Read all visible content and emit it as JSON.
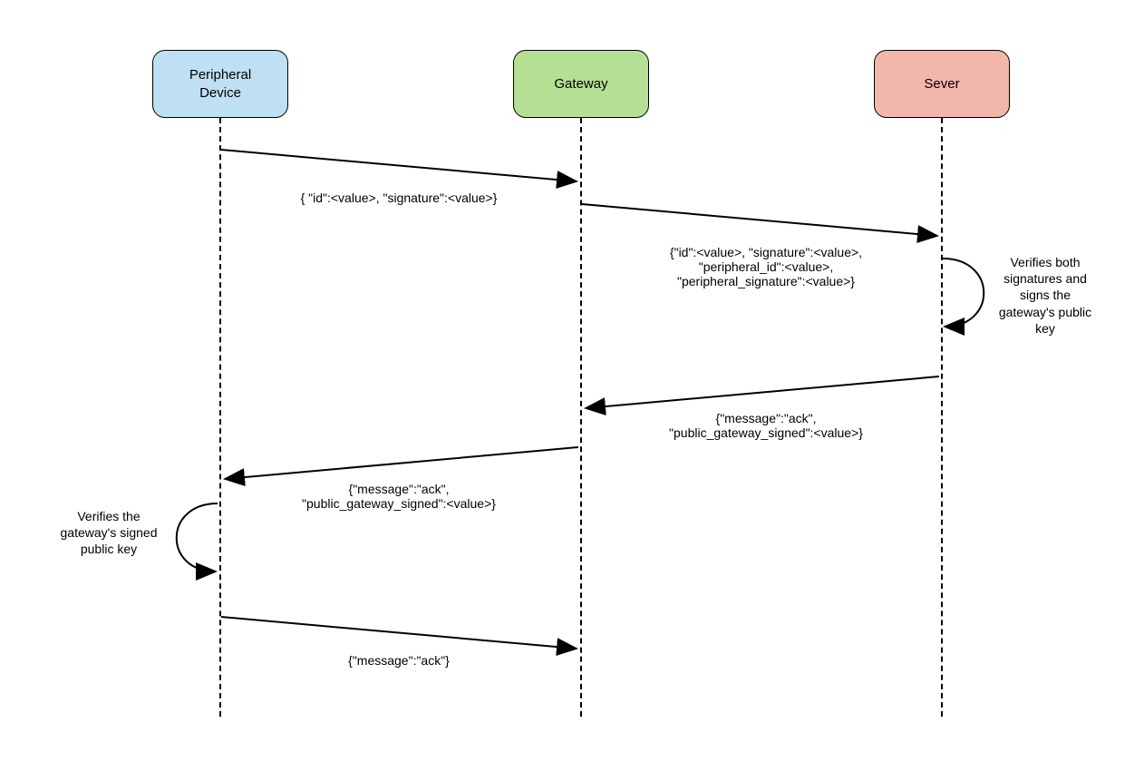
{
  "participants": {
    "peripheral": {
      "label": "Peripheral\nDevice",
      "color": "#bfdff3"
    },
    "gateway": {
      "label": "Gateway",
      "color": "#b5df92"
    },
    "server": {
      "label": "Sever",
      "color": "#f3b6ab"
    }
  },
  "messages": {
    "msg1": "{ \"id\":<value>, \"signature\":<value>}",
    "msg2": "{\"id\":<value>, \"signature\":<value>,\n\"peripheral_id\":<value>,\n\"peripheral_signature\":<value>}",
    "note1": "Verifies both\nsignatures and\nsigns the\ngateway's public\nkey",
    "msg3": "{\"message\":\"ack\",\n\"public_gateway_signed\":<value>}",
    "msg4": "{\"message\":\"ack\",\n\"public_gateway_signed\":<value>}",
    "note2": "Verifies the\ngateway's signed\npublic key",
    "msg5": "{\"message\":\"ack\"}"
  }
}
